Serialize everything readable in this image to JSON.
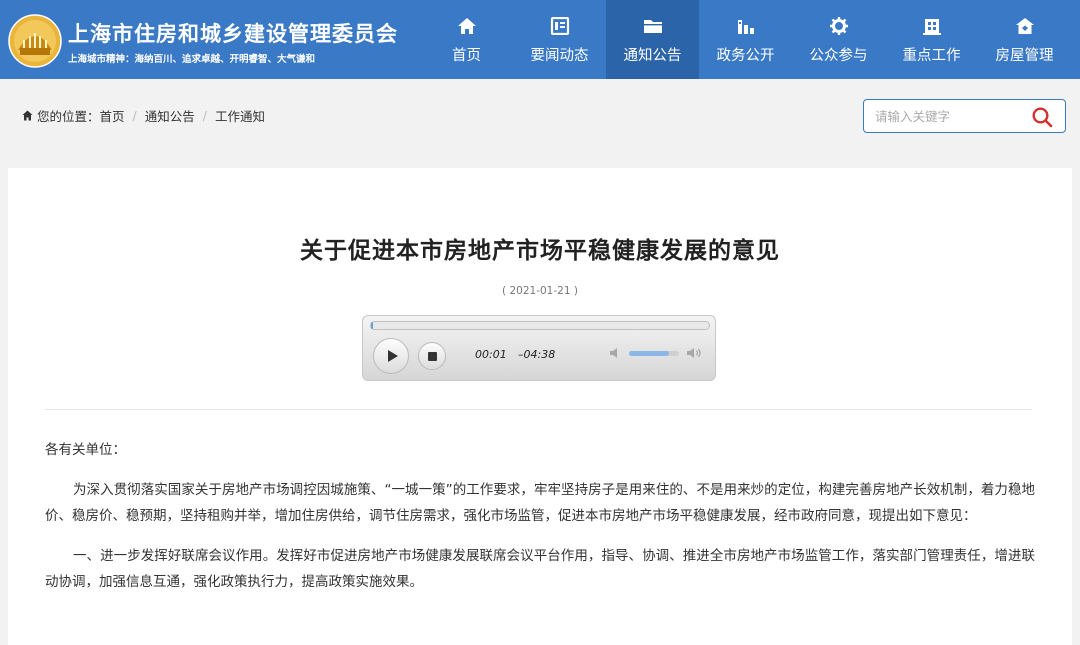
{
  "site": {
    "title": "上海市住房和城乡建设管理委员会",
    "motto": "上海城市精神：海纳百川、追求卓越、开明睿智、大气谦和",
    "brand_color": "#3a79c6",
    "active_nav_color": "#2b64a8"
  },
  "nav": {
    "items": [
      {
        "label": "首页",
        "icon": "home-icon"
      },
      {
        "label": "要闻动态",
        "icon": "news-icon"
      },
      {
        "label": "通知公告",
        "icon": "folder-icon",
        "active": true
      },
      {
        "label": "政务公开",
        "icon": "chart-icon"
      },
      {
        "label": "公众参与",
        "icon": "gear-icon"
      },
      {
        "label": "重点工作",
        "icon": "building-icon"
      },
      {
        "label": "房屋管理",
        "icon": "house-icon"
      }
    ]
  },
  "breadcrumb": {
    "prefix": "您的位置：",
    "items": [
      "首页",
      "通知公告",
      "工作通知"
    ]
  },
  "search": {
    "placeholder": "请输入关键字",
    "value": ""
  },
  "article": {
    "title": "关于促进本市房地产市场平稳健康发展的意见",
    "date": "( 2021-01-21 )",
    "salutation": "各有关单位：",
    "paragraphs": [
      "为深入贯彻落实国家关于房地产市场调控因城施策、“一城一策”的工作要求，牢牢坚持房子是用来住的、不是用来炒的定位，构建完善房地产长效机制，着力稳地价、稳房价、稳预期，坚持租购并举，增加住房供给，调节住房需求，强化市场监管，促进本市房地产市场平稳健康发展，经市政府同意，现提出如下意见：",
      "一、进一步发挥好联席会议作用。发挥好市促进房地产市场健康发展联席会议平台作用，指导、协调、推进全市房地产市场监管工作，落实部门管理责任，增进联动协调，加强信息互通，强化政策执行力，提高政策实施效果。"
    ]
  },
  "player": {
    "current_time": "00:01",
    "remaining_time": "–04:38",
    "progress": 0.004,
    "volume": 0.8
  }
}
